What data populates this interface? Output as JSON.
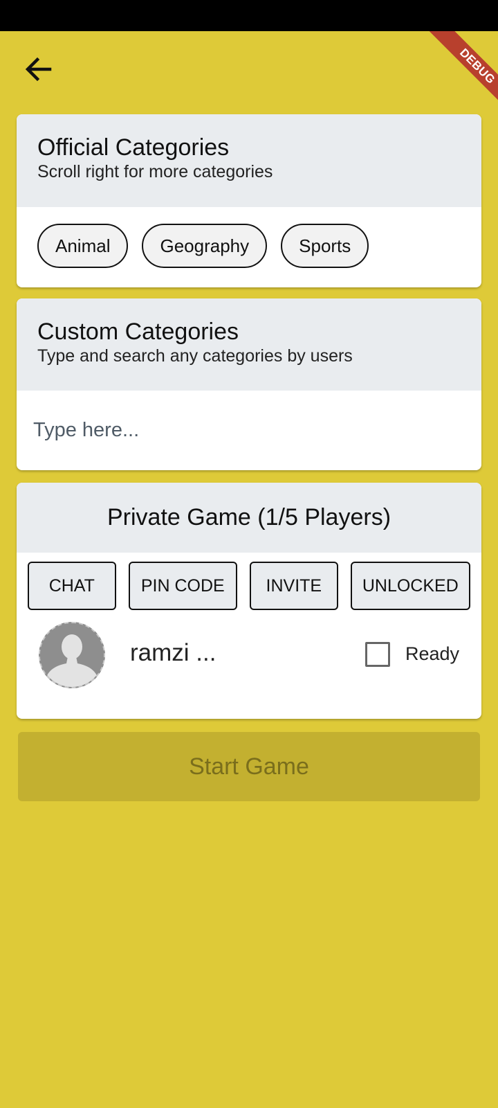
{
  "colors": {
    "background": "#DECA38",
    "status_bar": "#000000",
    "card_header": "#E9ECEF",
    "card_body": "#FFFFFF",
    "debug_ribbon": "#B8402D",
    "start_button_disabled": "#C3B030",
    "start_button_text_disabled": "#7A6E1C"
  },
  "debug_banner": {
    "label": "DEBUG"
  },
  "back_button": {
    "icon": "arrow-left-icon"
  },
  "official_categories": {
    "title": "Official Categories",
    "subtitle": "Scroll right for more categories",
    "chips": [
      {
        "label": "Animal"
      },
      {
        "label": "Geography"
      },
      {
        "label": "Sports"
      }
    ]
  },
  "custom_categories": {
    "title": "Custom Categories",
    "subtitle": "Type and search any categories by users",
    "search": {
      "value": "",
      "placeholder": "Type here..."
    }
  },
  "private_game": {
    "title": "Private Game (1/5 Players)",
    "actions": [
      {
        "label": "CHAT"
      },
      {
        "label": "PIN CODE"
      },
      {
        "label": "INVITE"
      },
      {
        "label": "UNLOCKED"
      }
    ],
    "players": [
      {
        "name": "ramzi ...",
        "avatar": "default-user-avatar",
        "ready": false,
        "ready_label": "Ready"
      }
    ]
  },
  "start_button": {
    "label": "Start Game",
    "enabled": false
  }
}
